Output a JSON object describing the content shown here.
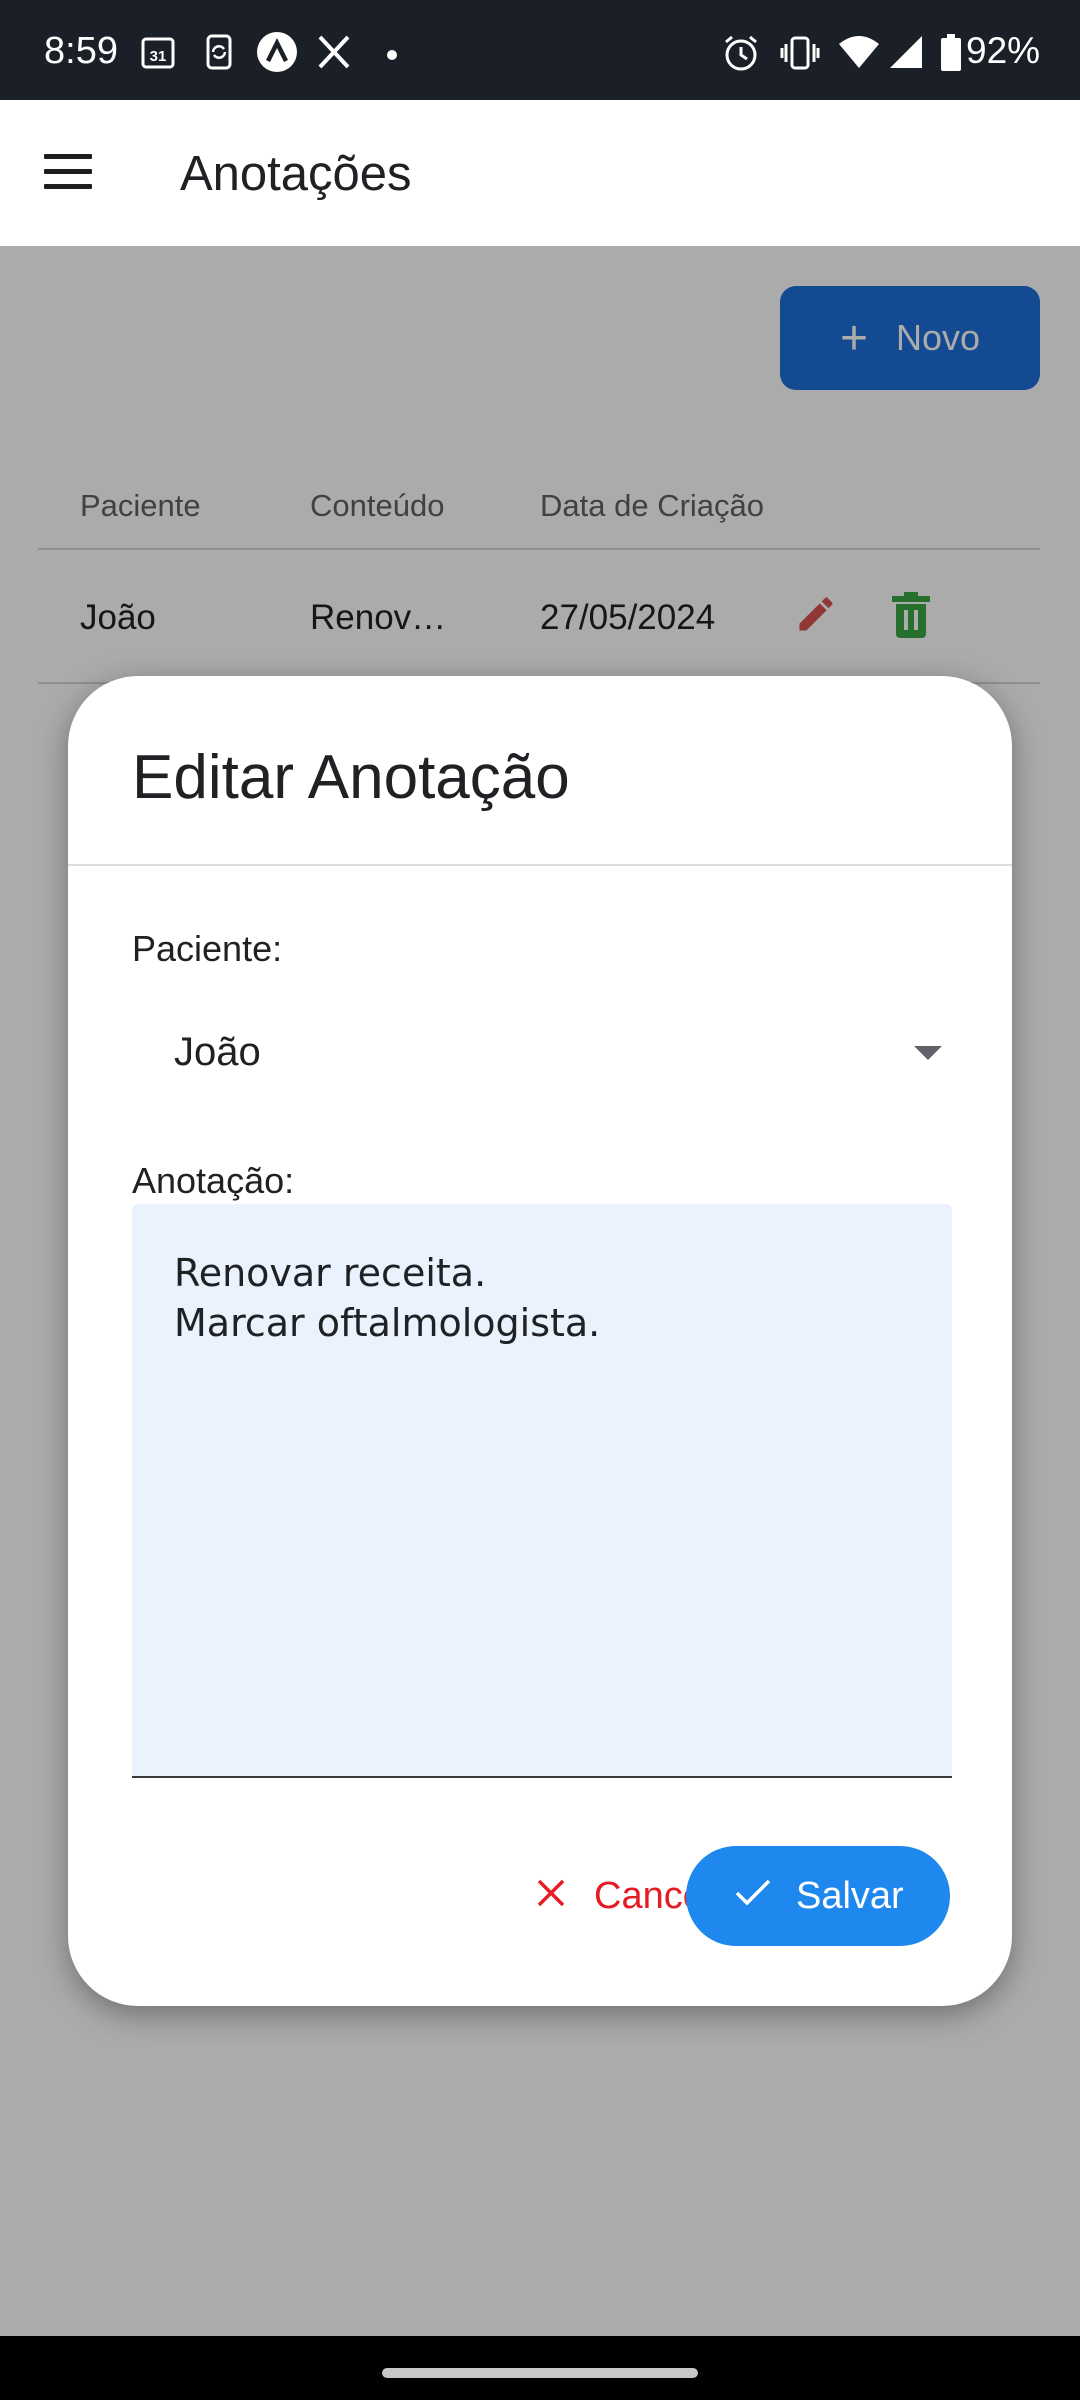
{
  "status_bar": {
    "time": "8:59",
    "battery": "92%",
    "icons": [
      "calendar-icon",
      "sync-icon",
      "app-icon",
      "x-icon",
      "dot-icon",
      "alarm-icon",
      "vibrate-icon",
      "wifi-icon",
      "signal-icon",
      "battery-icon"
    ],
    "calendar_day": "31"
  },
  "app_bar": {
    "title": "Anotações"
  },
  "page": {
    "new_button_label": "Novo",
    "table": {
      "columns": [
        "Paciente",
        "Conteúdo",
        "Data de Criação"
      ],
      "rows": [
        {
          "paciente": "João",
          "conteudo": "Renov…",
          "data": "27/05/2024"
        }
      ]
    }
  },
  "dialog": {
    "title": "Editar Anotação",
    "paciente_label": "Paciente:",
    "paciente_value": "João",
    "anotacao_label": "Anotação:",
    "anotacao_value": "Renovar receita.\nMarcar oftalmologista.",
    "cancel_label": "Cancel",
    "save_label": "Salvar"
  },
  "colors": {
    "primary": "#1e88ee",
    "danger": "#e51c23",
    "edit_icon": "#d9534f",
    "delete_icon": "#3aa845",
    "status_bar_bg": "#1b1f27"
  }
}
